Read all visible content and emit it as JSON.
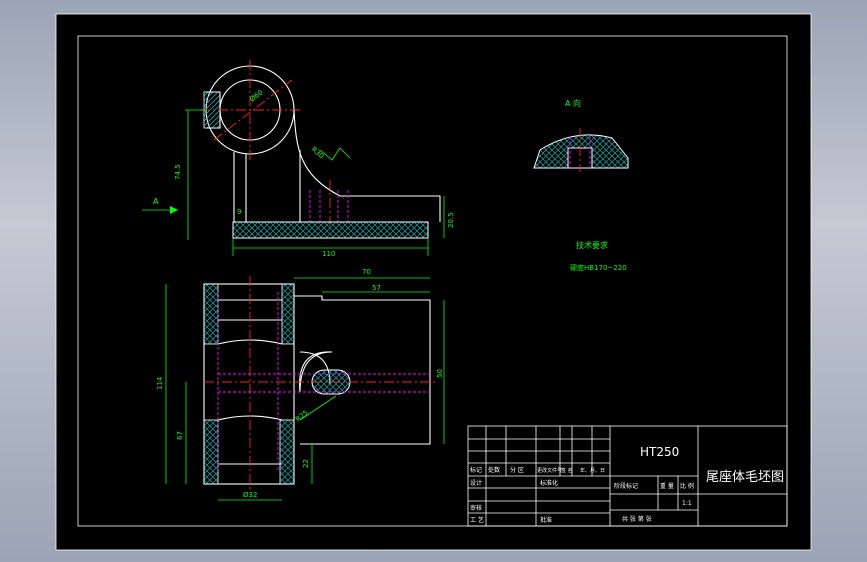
{
  "drawing": {
    "material": "HT250",
    "title": "尾座体毛坯图",
    "scale": "1:1",
    "view_label": "A 向",
    "arrow_label": "A",
    "tech_req_heading": "技术要求",
    "tech_req_text": "硬度HB170~220"
  },
  "dimensions": {
    "front": {
      "overall_height": "74.5",
      "base_length": "110",
      "base_thickness": "20.5",
      "left_offset": "9",
      "radius": "R30",
      "bore": "Ø60"
    },
    "plan": {
      "total_width": "70",
      "inner_width": "57",
      "overall_height": "114",
      "lower_height": "67",
      "right_height": "50",
      "bottom_offset": "22",
      "bore": "Ø32",
      "radius": "R25"
    }
  },
  "title_block": {
    "row_labels": [
      "标记",
      "处数",
      "分 区",
      "更改文件号",
      "签 名",
      "年、月、日"
    ],
    "designer": "设计",
    "standardize": "标准化",
    "review": "审核",
    "process": "工 艺",
    "approve": "批准",
    "stage_mark": "阶段标记",
    "weight": "重 量",
    "scale_label": "比 例",
    "sheets": "共 张  第 张"
  }
}
